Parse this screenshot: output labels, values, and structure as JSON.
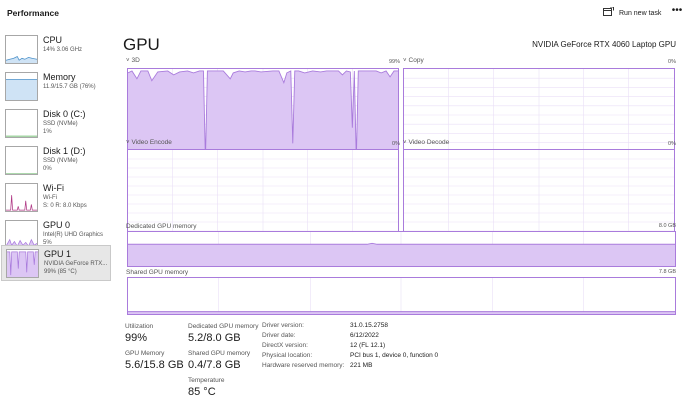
{
  "app": {
    "title": "Performance"
  },
  "toolbar": {
    "run_task": "Run new task",
    "more": "•••"
  },
  "sidebar": {
    "items": [
      {
        "name": "CPU",
        "sub1": "14% 3.06 GHz",
        "sub2": ""
      },
      {
        "name": "Memory",
        "sub1": "11.9/15.7 GB (76%)",
        "sub2": ""
      },
      {
        "name": "Disk 0 (C:)",
        "sub1": "SSD (NVMe)",
        "sub2": "1%"
      },
      {
        "name": "Disk 1 (D:)",
        "sub1": "SSD (NVMe)",
        "sub2": "0%"
      },
      {
        "name": "Wi-Fi",
        "sub1": "Wi-Fi",
        "sub2": "S: 0 R: 8.0 Kbps"
      },
      {
        "name": "GPU 0",
        "sub1": "Intel(R) UHD Graphics",
        "sub2": "5%"
      },
      {
        "name": "GPU 1",
        "sub1": "NVIDIA GeForce RTX...",
        "sub2": "99% (85 °C)"
      }
    ],
    "selected_index": 6
  },
  "main": {
    "title": "GPU",
    "device_name": "NVIDIA GeForce RTX 4060 Laptop GPU",
    "graphs": {
      "threed": {
        "label": "3D",
        "pct": "99%"
      },
      "copy": {
        "label": "Copy",
        "pct": "0%"
      },
      "video_encode": {
        "label": "Video Encode",
        "pct": "0%"
      },
      "video_decode": {
        "label": "Video Decode",
        "pct": "0%"
      },
      "dedicated": {
        "label": "Dedicated GPU memory",
        "max": "8.0 GB"
      },
      "shared": {
        "label": "Shared GPU memory",
        "max": "7.8 GB"
      }
    },
    "stats": {
      "utilization_label": "Utilization",
      "utilization_value": "99%",
      "dedicated_label": "Dedicated GPU memory",
      "dedicated_value": "5.2/8.0 GB",
      "gpu_memory_label": "GPU Memory",
      "gpu_memory_value": "5.6/15.8 GB",
      "shared_label": "Shared GPU memory",
      "shared_value": "0.4/7.8 GB",
      "temp_label": "Temperature",
      "temp_value": "85 °C"
    },
    "info": [
      {
        "key": "Driver version:",
        "value": "31.0.15.2758"
      },
      {
        "key": "Driver date:",
        "value": "6/12/2022"
      },
      {
        "key": "DirectX version:",
        "value": "12 (FL 12.1)"
      },
      {
        "key": "Physical location:",
        "value": "PCI bus 1, device 0, function 0"
      },
      {
        "key": "Hardware reserved memory:",
        "value": "221 MB"
      }
    ]
  },
  "colors": {
    "gpu_accent": "#a97bdc",
    "gpu_fill": "#dcc6f4",
    "cpu_accent": "#4a90c9",
    "cpu_fill": "#cfe3f5",
    "wifi_accent": "#b03a86",
    "grid": "#eadff7"
  }
}
